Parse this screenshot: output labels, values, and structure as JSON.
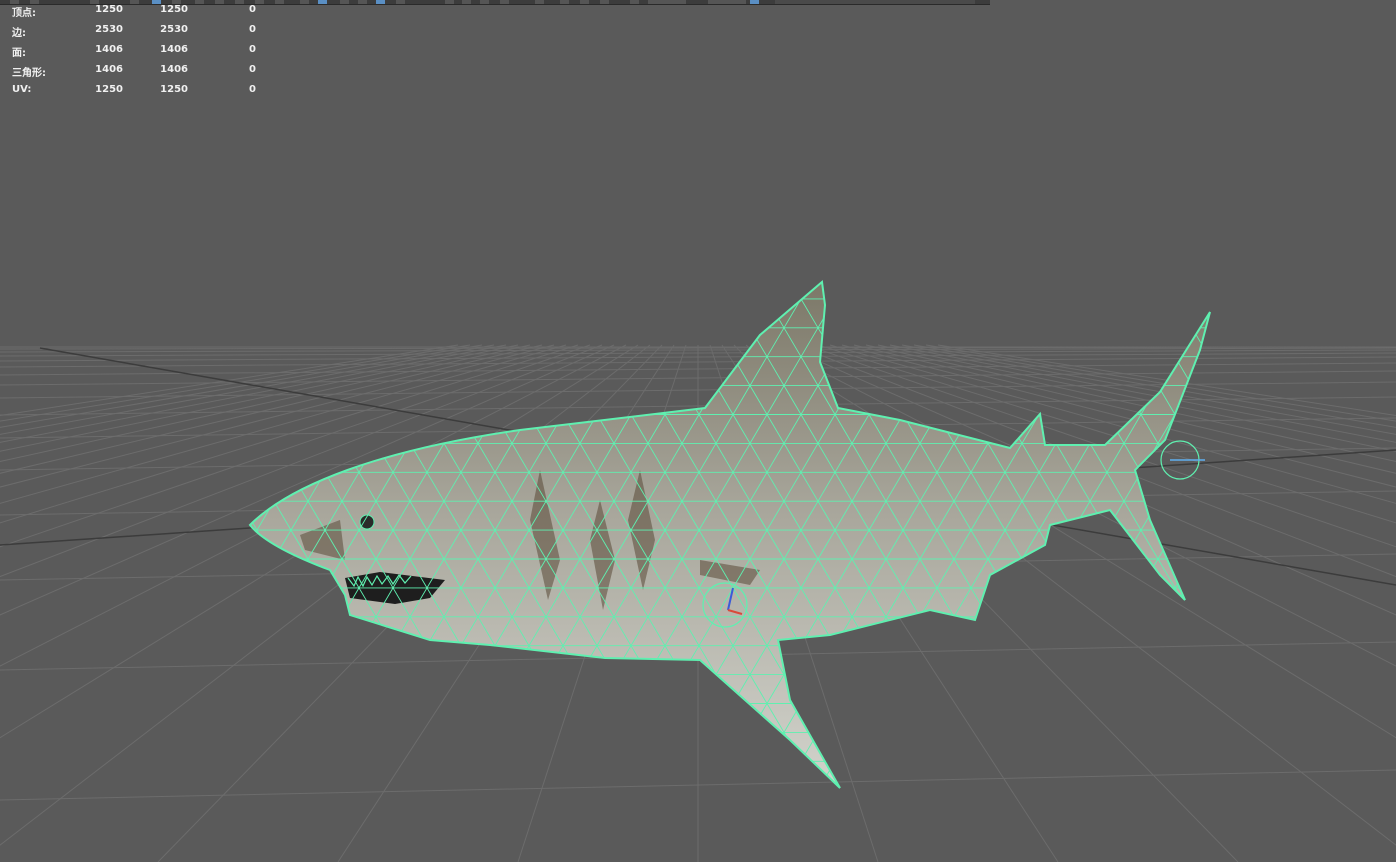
{
  "hud": {
    "rows": [
      {
        "label": "顶点:",
        "v1": "1250",
        "v2": "1250",
        "v3": "0"
      },
      {
        "label": "边:",
        "v1": "2530",
        "v2": "2530",
        "v3": "0"
      },
      {
        "label": "面:",
        "v1": "1406",
        "v2": "1406",
        "v3": "0"
      },
      {
        "label": "三角形:",
        "v1": "1406",
        "v2": "1406",
        "v3": "0"
      },
      {
        "label": "UV:",
        "v1": "1250",
        "v2": "1250",
        "v3": "0"
      }
    ]
  },
  "colors": {
    "background": "#5a5a5a",
    "wireframe": "#5ff0b0",
    "grid": "#6e6e6e",
    "shark_body": "#8f8c80"
  }
}
